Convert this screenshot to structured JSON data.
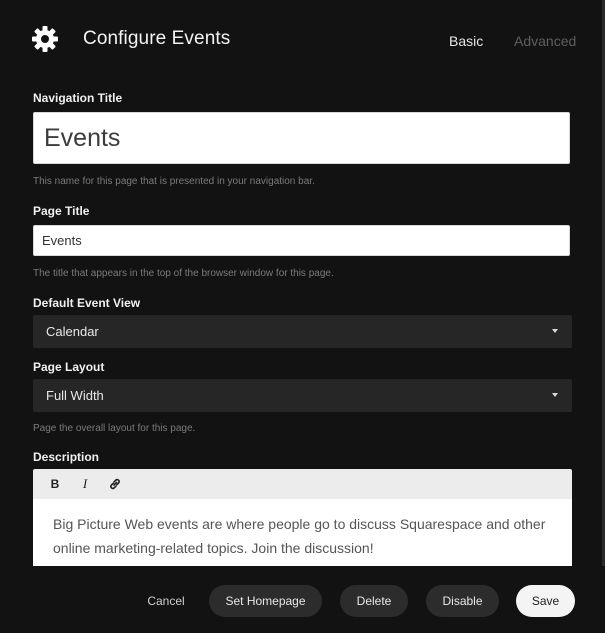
{
  "header": {
    "title": "Configure Events",
    "tabs": [
      {
        "label": "Basic",
        "active": true
      },
      {
        "label": "Advanced",
        "active": false
      }
    ],
    "icon": "gear-icon"
  },
  "form": {
    "navigation_title": {
      "label": "Navigation Title",
      "value": "Events",
      "help": "This name for this page that is presented in your navigation bar."
    },
    "page_title": {
      "label": "Page Title",
      "value": "Events",
      "help": "The title that appears in the top of the browser window for this page."
    },
    "default_event_view": {
      "label": "Default Event View",
      "selected": "Calendar"
    },
    "page_layout": {
      "label": "Page Layout",
      "selected": "Full Width",
      "help": "Page the overall layout for this page."
    },
    "description": {
      "label": "Description",
      "toolbar": {
        "bold": "B",
        "italic": "I"
      },
      "text": "Big Picture Web events are where people go to discuss Squarespace and other online marketing-related topics. Join the discussion!"
    }
  },
  "footer": {
    "cancel": "Cancel",
    "set_homepage": "Set Homepage",
    "delete": "Delete",
    "disable": "Disable",
    "save": "Save"
  },
  "colors": {
    "background": "#121212",
    "input_bg": "#ffffff",
    "select_bg": "#262626",
    "save_bg": "#f4f4f4"
  }
}
